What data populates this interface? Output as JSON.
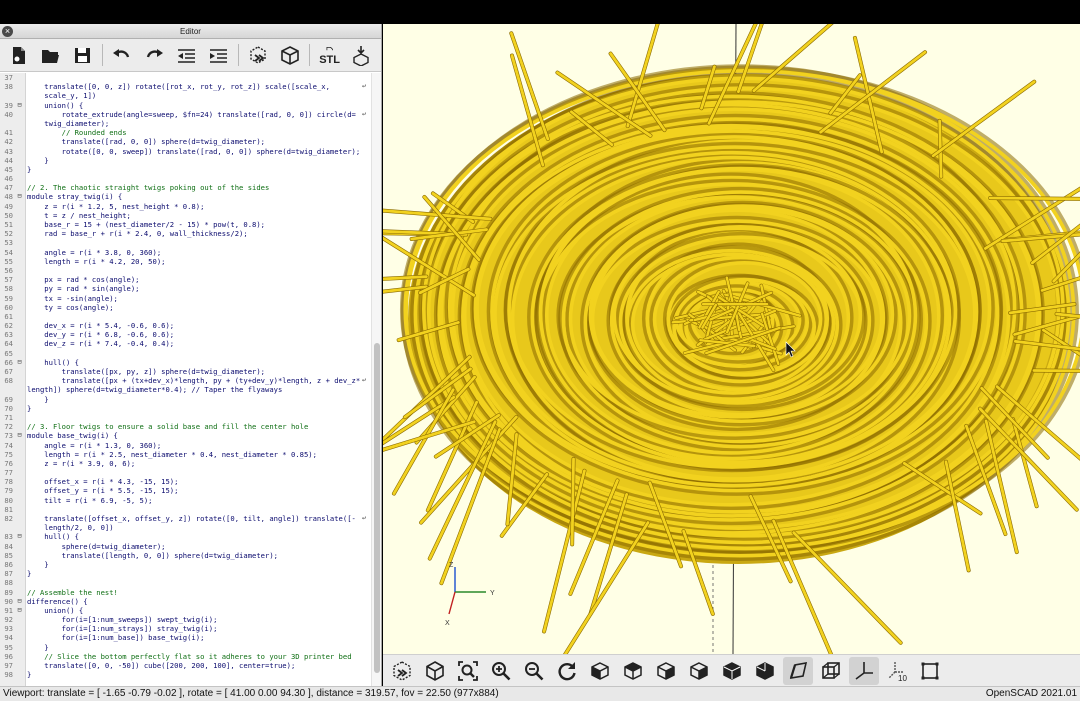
{
  "window": {
    "editor_title": "Editor"
  },
  "editor": {
    "lines": [
      {
        "n": "37",
        "fold": "",
        "text": "",
        "cls": "",
        "wrap": false
      },
      {
        "n": "38",
        "fold": "",
        "text": "    translate([0, 0, z]) rotate([rot_x, rot_y, rot_z]) scale([scale_x,",
        "cls": "",
        "wrap": true
      },
      {
        "n": "",
        "fold": "",
        "text": "    scale_y, 1])",
        "cls": "",
        "wrap": false
      },
      {
        "n": "39",
        "fold": "⊟",
        "text": "    union() {",
        "cls": "",
        "wrap": false
      },
      {
        "n": "40",
        "fold": "",
        "text": "        rotate_extrude(angle=sweep, $fn=24) translate([rad, 0, 0]) circle(d=",
        "cls": "",
        "wrap": true
      },
      {
        "n": "",
        "fold": "",
        "text": "    twig_diameter);",
        "cls": "",
        "wrap": false
      },
      {
        "n": "41",
        "fold": "",
        "text": "        // Rounded ends",
        "cls": "comment",
        "wrap": false
      },
      {
        "n": "42",
        "fold": "",
        "text": "        translate([rad, 0, 0]) sphere(d=twig_diameter);",
        "cls": "",
        "wrap": false
      },
      {
        "n": "43",
        "fold": "",
        "text": "        rotate([0, 0, sweep]) translate([rad, 0, 0]) sphere(d=twig_diameter);",
        "cls": "",
        "wrap": false
      },
      {
        "n": "44",
        "fold": "",
        "text": "    }",
        "cls": "",
        "wrap": false
      },
      {
        "n": "45",
        "fold": "",
        "text": "}",
        "cls": "",
        "wrap": false
      },
      {
        "n": "46",
        "fold": "",
        "text": "",
        "cls": "",
        "wrap": false
      },
      {
        "n": "47",
        "fold": "",
        "text": "// 2. The chaotic straight twigs poking out of the sides",
        "cls": "comment",
        "wrap": false
      },
      {
        "n": "48",
        "fold": "⊟",
        "text": "module stray_twig(i) {",
        "cls": "",
        "wrap": false
      },
      {
        "n": "49",
        "fold": "",
        "text": "    z = r(i * 1.2, 5, nest_height * 0.8);",
        "cls": "",
        "wrap": false
      },
      {
        "n": "50",
        "fold": "",
        "text": "    t = z / nest_height;",
        "cls": "",
        "wrap": false
      },
      {
        "n": "51",
        "fold": "",
        "text": "    base_r = 15 + (nest_diameter/2 - 15) * pow(t, 0.8);",
        "cls": "",
        "wrap": false
      },
      {
        "n": "52",
        "fold": "",
        "text": "    rad = base_r + r(i * 2.4, 0, wall_thickness/2);",
        "cls": "",
        "wrap": false
      },
      {
        "n": "53",
        "fold": "",
        "text": "",
        "cls": "",
        "wrap": false
      },
      {
        "n": "54",
        "fold": "",
        "text": "    angle = r(i * 3.8, 0, 360);",
        "cls": "",
        "wrap": false
      },
      {
        "n": "55",
        "fold": "",
        "text": "    length = r(i * 4.2, 20, 50);",
        "cls": "",
        "wrap": false
      },
      {
        "n": "56",
        "fold": "",
        "text": "",
        "cls": "",
        "wrap": false
      },
      {
        "n": "57",
        "fold": "",
        "text": "    px = rad * cos(angle);",
        "cls": "",
        "wrap": false
      },
      {
        "n": "58",
        "fold": "",
        "text": "    py = rad * sin(angle);",
        "cls": "",
        "wrap": false
      },
      {
        "n": "59",
        "fold": "",
        "text": "    tx = -sin(angle);",
        "cls": "",
        "wrap": false
      },
      {
        "n": "60",
        "fold": "",
        "text": "    ty = cos(angle);",
        "cls": "",
        "wrap": false
      },
      {
        "n": "61",
        "fold": "",
        "text": "",
        "cls": "",
        "wrap": false
      },
      {
        "n": "62",
        "fold": "",
        "text": "    dev_x = r(i * 5.4, -0.6, 0.6);",
        "cls": "",
        "wrap": false
      },
      {
        "n": "63",
        "fold": "",
        "text": "    dev_y = r(i * 6.8, -0.6, 0.6);",
        "cls": "",
        "wrap": false
      },
      {
        "n": "64",
        "fold": "",
        "text": "    dev_z = r(i * 7.4, -0.4, 0.4);",
        "cls": "",
        "wrap": false
      },
      {
        "n": "65",
        "fold": "",
        "text": "",
        "cls": "",
        "wrap": false
      },
      {
        "n": "66",
        "fold": "⊟",
        "text": "    hull() {",
        "cls": "",
        "wrap": false
      },
      {
        "n": "67",
        "fold": "",
        "text": "        translate([px, py, z]) sphere(d=twig_diameter);",
        "cls": "",
        "wrap": false
      },
      {
        "n": "68",
        "fold": "",
        "text": "        translate([px + (tx+dev_x)*length, py + (ty+dev_y)*length, z + dev_z*",
        "cls": "",
        "wrap": true
      },
      {
        "n": "",
        "fold": "",
        "text": "length]) sphere(d=twig_diameter*0.4); // Taper the flyaways",
        "cls": "",
        "wrap": false
      },
      {
        "n": "69",
        "fold": "",
        "text": "    }",
        "cls": "",
        "wrap": false
      },
      {
        "n": "70",
        "fold": "",
        "text": "}",
        "cls": "",
        "wrap": false
      },
      {
        "n": "71",
        "fold": "",
        "text": "",
        "cls": "",
        "wrap": false
      },
      {
        "n": "72",
        "fold": "",
        "text": "// 3. Floor twigs to ensure a solid base and fill the center hole",
        "cls": "comment",
        "wrap": false
      },
      {
        "n": "73",
        "fold": "⊟",
        "text": "module base_twig(i) {",
        "cls": "",
        "wrap": false
      },
      {
        "n": "74",
        "fold": "",
        "text": "    angle = r(i * 1.3, 0, 360);",
        "cls": "",
        "wrap": false
      },
      {
        "n": "75",
        "fold": "",
        "text": "    length = r(i * 2.5, nest_diameter * 0.4, nest_diameter * 0.85);",
        "cls": "",
        "wrap": false
      },
      {
        "n": "76",
        "fold": "",
        "text": "    z = r(i * 3.9, 0, 6);",
        "cls": "",
        "wrap": false
      },
      {
        "n": "77",
        "fold": "",
        "text": "",
        "cls": "",
        "wrap": false
      },
      {
        "n": "78",
        "fold": "",
        "text": "    offset_x = r(i * 4.3, -15, 15);",
        "cls": "",
        "wrap": false
      },
      {
        "n": "79",
        "fold": "",
        "text": "    offset_y = r(i * 5.5, -15, 15);",
        "cls": "",
        "wrap": false
      },
      {
        "n": "80",
        "fold": "",
        "text": "    tilt = r(i * 6.9, -5, 5);",
        "cls": "",
        "wrap": false
      },
      {
        "n": "81",
        "fold": "",
        "text": "",
        "cls": "",
        "wrap": false
      },
      {
        "n": "82",
        "fold": "",
        "text": "    translate([offset_x, offset_y, z]) rotate([0, tilt, angle]) translate([-",
        "cls": "",
        "wrap": true
      },
      {
        "n": "",
        "fold": "",
        "text": "    length/2, 0, 0])",
        "cls": "",
        "wrap": false
      },
      {
        "n": "83",
        "fold": "⊟",
        "text": "    hull() {",
        "cls": "",
        "wrap": false
      },
      {
        "n": "84",
        "fold": "",
        "text": "        sphere(d=twig_diameter);",
        "cls": "",
        "wrap": false
      },
      {
        "n": "85",
        "fold": "",
        "text": "        translate([length, 0, 0]) sphere(d=twig_diameter);",
        "cls": "",
        "wrap": false
      },
      {
        "n": "86",
        "fold": "",
        "text": "    }",
        "cls": "",
        "wrap": false
      },
      {
        "n": "87",
        "fold": "",
        "text": "}",
        "cls": "",
        "wrap": false
      },
      {
        "n": "88",
        "fold": "",
        "text": "",
        "cls": "",
        "wrap": false
      },
      {
        "n": "89",
        "fold": "",
        "text": "// Assemble the nest!",
        "cls": "comment",
        "wrap": false
      },
      {
        "n": "90",
        "fold": "⊟",
        "text": "difference() {",
        "cls": "",
        "wrap": false
      },
      {
        "n": "91",
        "fold": "⊟",
        "text": "    union() {",
        "cls": "",
        "wrap": false
      },
      {
        "n": "92",
        "fold": "",
        "text": "        for(i=[1:num_sweeps]) swept_twig(i);",
        "cls": "",
        "wrap": false
      },
      {
        "n": "93",
        "fold": "",
        "text": "        for(i=[1:num_strays]) stray_twig(i);",
        "cls": "",
        "wrap": false
      },
      {
        "n": "94",
        "fold": "",
        "text": "        for(i=[1:num_base]) base_twig(i);",
        "cls": "",
        "wrap": false
      },
      {
        "n": "95",
        "fold": "",
        "text": "    }",
        "cls": "",
        "wrap": false
      },
      {
        "n": "96",
        "fold": "",
        "text": "    // Slice the bottom perfectly flat so it adheres to your 3D printer bed",
        "cls": "comment",
        "wrap": false
      },
      {
        "n": "97",
        "fold": "",
        "text": "    translate([0, 0, -50]) cube([200, 200, 100], center=true);",
        "cls": "",
        "wrap": false
      },
      {
        "n": "98",
        "fold": "",
        "text": "}",
        "cls": "",
        "wrap": false
      }
    ]
  },
  "viewport": {
    "background": "#ffffe6",
    "twig_color": "#f2d21f",
    "twig_dark": "#8a6a00",
    "axes": {
      "z_label": "Z",
      "x_label": "X",
      "y_label": "Y"
    }
  },
  "toolbar_icons": [
    "new-file-icon",
    "open-file-icon",
    "save-icon",
    "undo-icon",
    "redo-icon",
    "unindent-icon",
    "indent-icon",
    "preview-icon",
    "render-icon",
    "export-stl-icon",
    "send-to-print-icon"
  ],
  "toolbar_stl_label": "STL",
  "status": {
    "viewport_text": "Viewport: translate = [ -1.65 -0.79 -0.02 ], rotate = [ 41.00 0.00 94.30 ], distance = 319.57, fov = 22.50 (977x884)",
    "version_text": "OpenSCAD 2021.01"
  }
}
